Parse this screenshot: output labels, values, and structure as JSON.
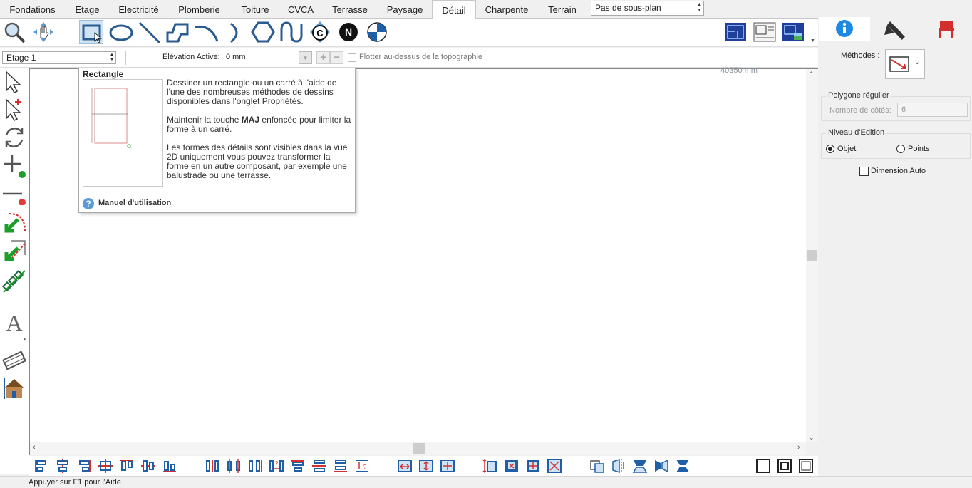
{
  "tabs": [
    "Fondations",
    "Etage",
    "Electricité",
    "Plomberie",
    "Toiture",
    "CVCA",
    "Terrasse",
    "Paysage",
    "Détail",
    "Charpente",
    "Terrain"
  ],
  "subplan_select": "Pas de sous-plan",
  "options": {
    "floor": "Etage 1",
    "elevation_label": "Elévation Active:",
    "elevation_value": "0 mm",
    "plus": "+",
    "minus": "−",
    "float_label": "Flotter au-dessus de la topographie"
  },
  "canvas": {
    "coordinate_readout": "40350 mm"
  },
  "tooltip": {
    "title": "Rectangle",
    "para1": "Dessiner un rectangle ou un carré à l'aide de l'une des nombreuses méthodes de dessins disponibles dans l'onglet Propriétés.",
    "para2_before": "Maintenir la touche ",
    "para2_key": "MAJ",
    "para2_after": " enfoncée pour limiter la forme à un carré.",
    "para3": "Les formes des détails sont visibles dans la vue 2D uniquement vous pouvez transformer la forme en un autre composant, par exemple une balustrade ou une terrasse.",
    "help_icon": "?",
    "manual_link": "Manuel d'utilisation"
  },
  "right_panel": {
    "methods_label": "Méthodes :",
    "polygon_group": "Polygone régulier",
    "sides_label": "Nombre de côtés:",
    "sides_value": "6",
    "edit_level_group": "Niveau d'Edition",
    "object_radio": "Objet",
    "points_radio": "Points",
    "auto_dimension": "Dimension Auto"
  },
  "status_bar": "Appuyer sur F1 pour l'Aide",
  "colors": {
    "accent_blue": "#1f5fa8",
    "help_blue": "#5b9bd5",
    "info_blue": "#1e88e5",
    "red": "#d32f2f",
    "green": "#1b9e2a"
  }
}
